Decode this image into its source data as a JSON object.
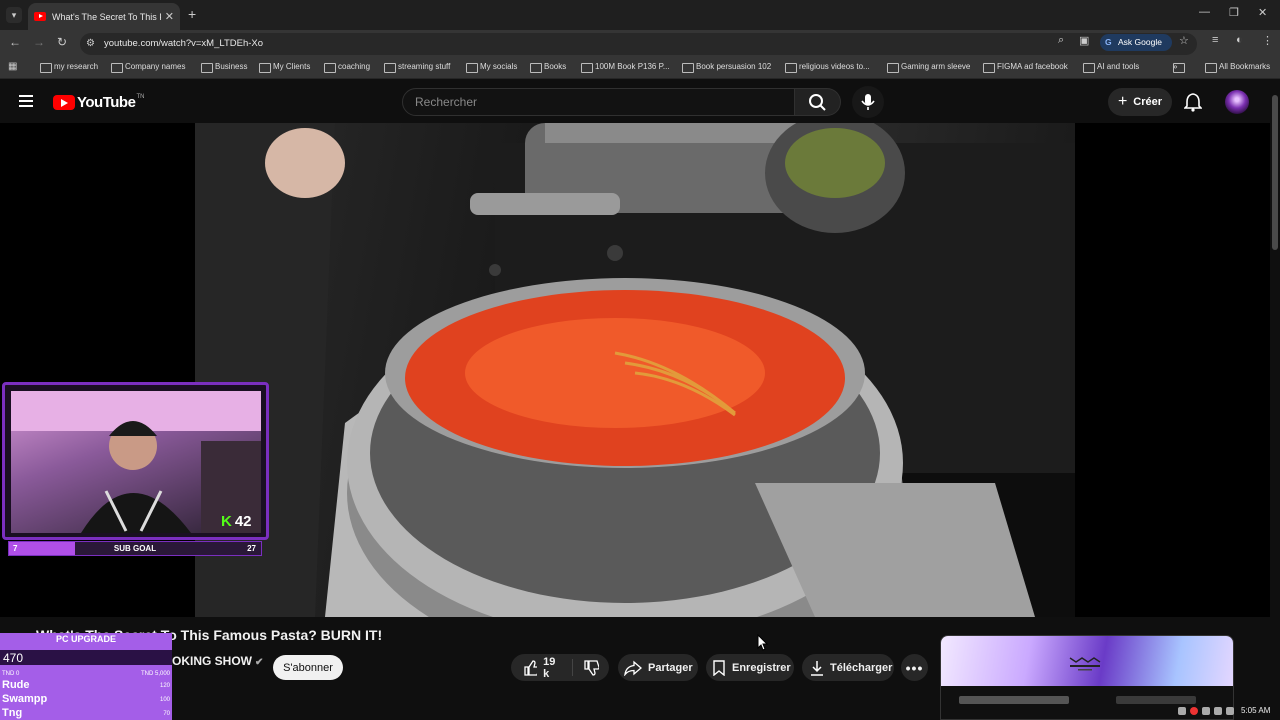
{
  "browser": {
    "tab_title": "What's The Secret To This Famous Pasta? BURN IT!",
    "tab_title_short": "What's The Secret To This Famo",
    "url": "youtube.com/watch?v=xM_LTDEh-Xo",
    "ask_google": "Ask Google",
    "bookmarks": [
      "my research",
      "Company names",
      "Business",
      "My Clients",
      "coaching",
      "streaming stuff",
      "My socials",
      "Books",
      "100M Book P136 P...",
      "Book persuasion 102",
      "religious videos to...",
      "Gaming arm sleeve",
      "FIGMA ad facebook",
      "AI and tools"
    ],
    "all_bookmarks": "All Bookmarks"
  },
  "youtube": {
    "logo_text": "YouTube",
    "logo_region": "TN",
    "search_placeholder": "Rechercher",
    "create_label": "Créer"
  },
  "video": {
    "title": "What's The Secret To This Famous Pasta? BURN IT!",
    "channel_partial": "OKING SHOW",
    "subscribe_label": "S'abonner",
    "likes": "19 k",
    "share_label": "Partager",
    "save_label": "Enregistrer",
    "download_label": "Télécharger"
  },
  "overlay": {
    "kick_count": "42",
    "sub_goal": {
      "label": "SUB GOAL",
      "current": "7",
      "target": "27",
      "progress": 0.26
    },
    "pc_upgrade": {
      "title": "PC UPGRADE",
      "value": "470",
      "min": "TND 0",
      "max": "TND 5,000",
      "donors": [
        {
          "name": "Rude",
          "amount": "120"
        },
        {
          "name": "Swampp",
          "amount": "100"
        },
        {
          "name": "Tng",
          "amount": "70"
        }
      ]
    }
  },
  "tray": {
    "time": "5:05 AM"
  },
  "colors": {
    "youtube_red": "#ff0000",
    "kick_green": "#53fc18",
    "overlay_purple": "#7b2fc0"
  }
}
